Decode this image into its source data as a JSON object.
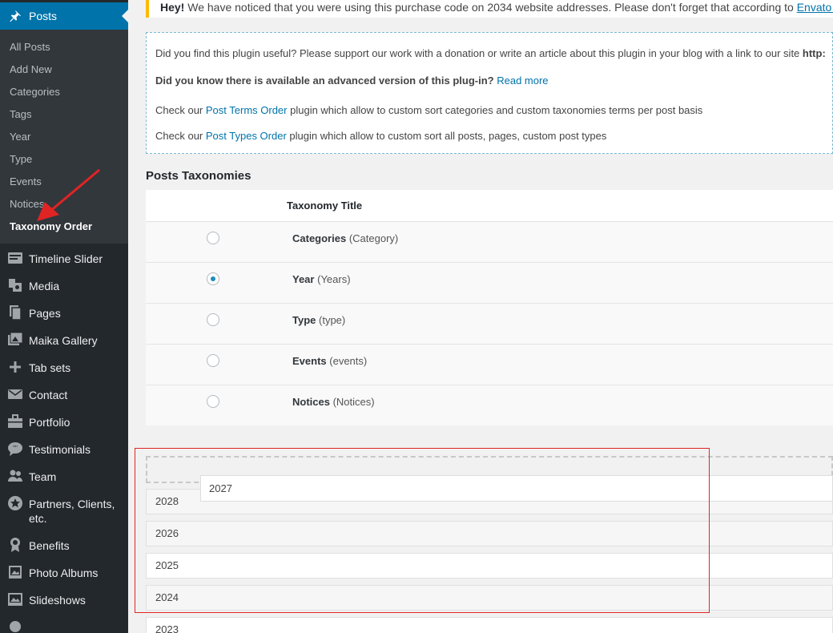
{
  "sidebar": {
    "posts_label": "Posts",
    "submenu": [
      {
        "label": "All Posts"
      },
      {
        "label": "Add New"
      },
      {
        "label": "Categories"
      },
      {
        "label": "Tags"
      },
      {
        "label": "Year"
      },
      {
        "label": "Type"
      },
      {
        "label": "Events"
      },
      {
        "label": "Notices"
      },
      {
        "label": "Taxonomy Order"
      }
    ],
    "menu": [
      {
        "label": "Timeline Slider",
        "icon": "timeline-icon"
      },
      {
        "label": "Media",
        "icon": "media-icon"
      },
      {
        "label": "Pages",
        "icon": "pages-icon"
      },
      {
        "label": "Maika Gallery",
        "icon": "gallery-icon"
      },
      {
        "label": "Tab sets",
        "icon": "plus-icon"
      },
      {
        "label": "Contact",
        "icon": "mail-icon"
      },
      {
        "label": "Portfolio",
        "icon": "portfolio-icon"
      },
      {
        "label": "Testimonials",
        "icon": "testimonials-icon"
      },
      {
        "label": "Team",
        "icon": "team-icon"
      },
      {
        "label": "Partners, Clients, etc.",
        "icon": "star-icon"
      },
      {
        "label": "Benefits",
        "icon": "award-icon"
      },
      {
        "label": "Photo Albums",
        "icon": "photo-icon"
      },
      {
        "label": "Slideshows",
        "icon": "slideshow-icon"
      }
    ]
  },
  "notice": {
    "bold": "Hey!",
    "text": " We have noticed that you were using this purchase code on 2034 website addresses. Please don't forget that according to ",
    "link": "Envato Standard Li"
  },
  "info": {
    "line1": "Did you find this plugin useful? Please support our work with a donation or write an article about this plugin in your blog with a link to our site ",
    "line1_bold": "http:",
    "line2_bold": "Did you know there is available an advanced version of this plug-in?",
    "line2_link": "Read more",
    "line3_pre": "Check our ",
    "line3_link": "Post Terms Order",
    "line3_post": " plugin which allow to custom sort categories and custom taxonomies terms per post basis",
    "line4_pre": "Check our ",
    "line4_link": "Post Types Order",
    "line4_post": " plugin which allow to custom sort all posts, pages, custom post types"
  },
  "taxonomies": {
    "section_title": "Posts Taxonomies",
    "column_title": "Taxonomy Title",
    "rows": [
      {
        "name": "Categories",
        "slug": "(Category)",
        "selected": false
      },
      {
        "name": "Year",
        "slug": "(Years)",
        "selected": true
      },
      {
        "name": "Type",
        "slug": "(type)",
        "selected": false
      },
      {
        "name": "Events",
        "slug": "(events)",
        "selected": false
      },
      {
        "name": "Notices",
        "slug": "(Notices)",
        "selected": false
      }
    ]
  },
  "sortable": {
    "dragging": "2027",
    "items": [
      "2028",
      "2026",
      "2025",
      "2024",
      "2023"
    ]
  }
}
